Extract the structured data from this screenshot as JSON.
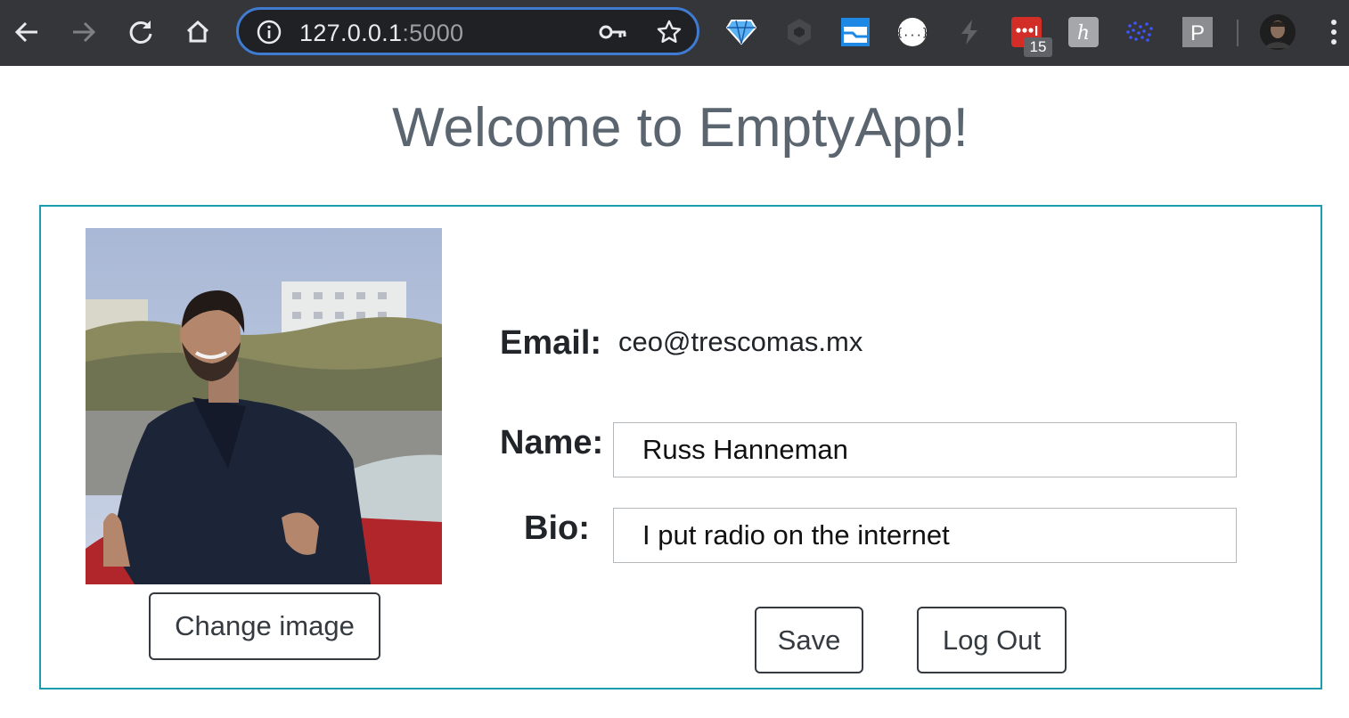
{
  "browser": {
    "url_host": "127.0.0.1",
    "url_port": ":5000",
    "extension_badge": "15",
    "extensions": [
      "diamond-extension-icon",
      "hexagon-extension-icon",
      "windows-extension-icon",
      "json-viewer-extension-icon",
      "bolt-extension-icon",
      "lastpass-extension-icon",
      "kindle-extension-icon",
      "dots-extension-icon",
      "p-extension-icon"
    ],
    "json_ext_label": "{...}",
    "p_ext_label": "P",
    "h_ext_label": "h"
  },
  "page": {
    "title": "Welcome to EmptyApp!"
  },
  "profile": {
    "change_image_label": "Change image",
    "email_label": "Email:",
    "email_value": "ceo@trescomas.mx",
    "name_label": "Name:",
    "name_value": "Russ Hanneman",
    "bio_label": "Bio:",
    "bio_value": "I put radio on the internet",
    "save_label": "Save",
    "logout_label": "Log Out"
  },
  "colors": {
    "toolbar_bg": "#35363a",
    "omnibox_border": "#3f7bd0",
    "card_border": "#1b9db0",
    "title_text": "#5b6570"
  }
}
